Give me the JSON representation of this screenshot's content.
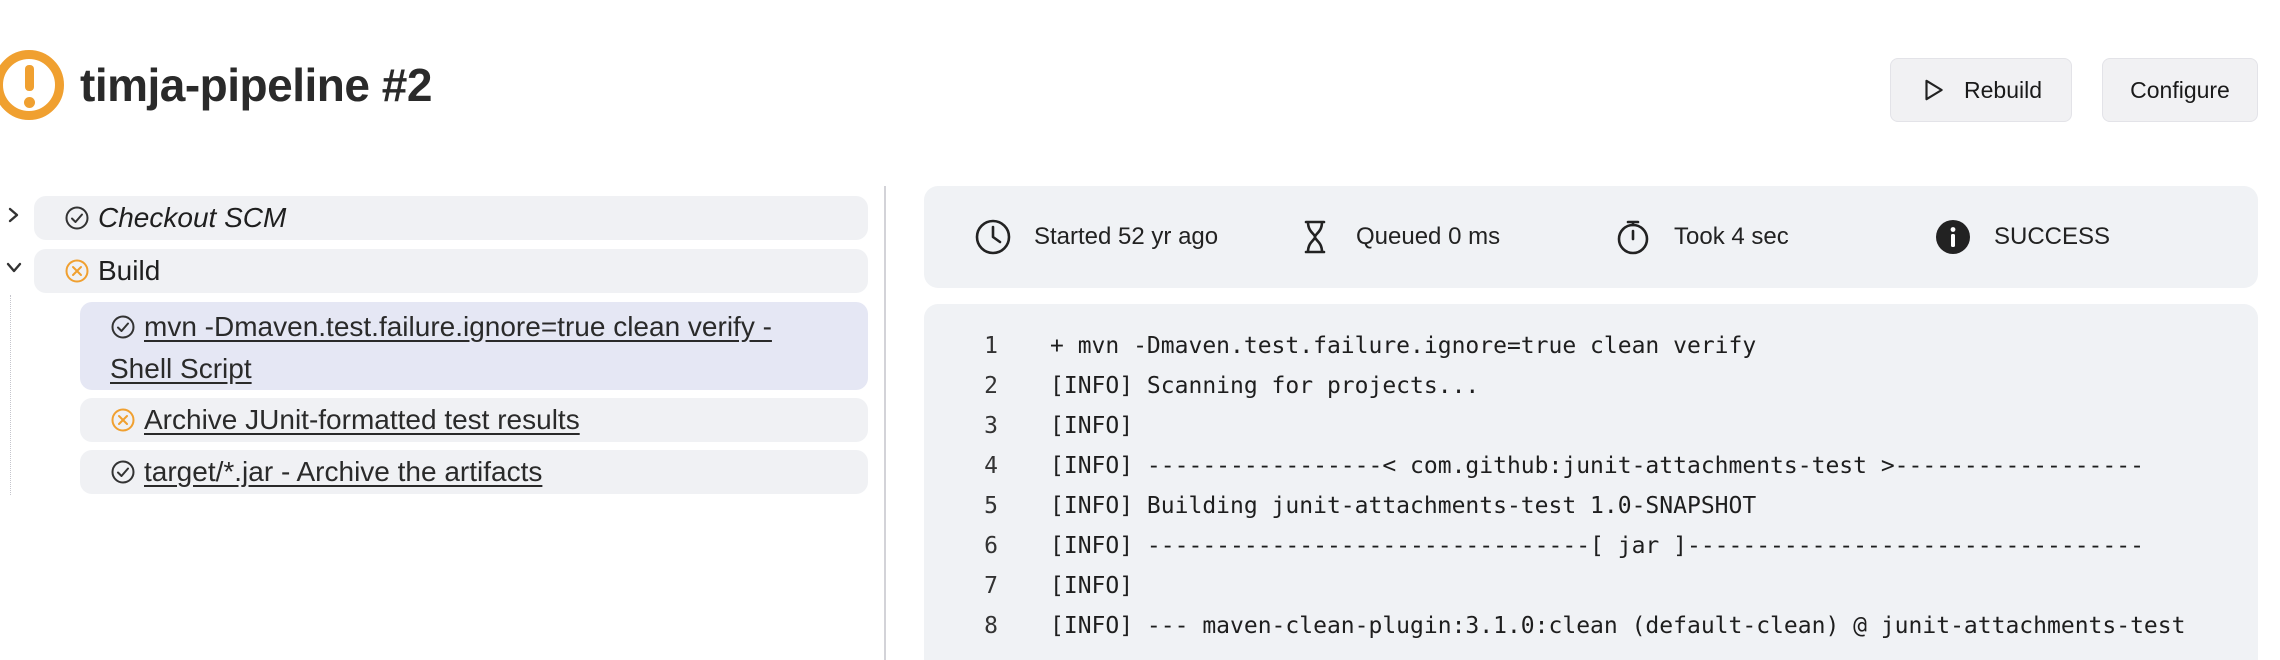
{
  "header": {
    "title": "timja-pipeline #2",
    "rebuild_label": "Rebuild",
    "configure_label": "Configure",
    "status_color": "#f0a030"
  },
  "stages": [
    {
      "label": "Checkout SCM",
      "status": "success",
      "expanded": false
    },
    {
      "label": "Build",
      "status": "failure",
      "expanded": true
    }
  ],
  "steps": [
    {
      "label": "mvn -Dmaven.test.failure.ignore=true clean verify - Shell Script",
      "line1": "mvn -Dmaven.test.failure.ignore=true clean verify -",
      "line2": "Shell Script",
      "status": "success",
      "selected": true
    },
    {
      "label": "Archive JUnit-formatted test results",
      "status": "failure",
      "selected": false
    },
    {
      "label": "target/*.jar - Archive the artifacts",
      "status": "success",
      "selected": false
    }
  ],
  "summary": {
    "started": "Started 52 yr ago",
    "queued": "Queued 0 ms",
    "took": "Took 4 sec",
    "result": "SUCCESS"
  },
  "console": {
    "lines": [
      {
        "n": "1",
        "text": "+ mvn -Dmaven.test.failure.ignore=true clean verify"
      },
      {
        "n": "2",
        "text": "[INFO] Scanning for projects..."
      },
      {
        "n": "3",
        "text": "[INFO]"
      },
      {
        "n": "4",
        "text": "[INFO] -----------------< com.github:junit-attachments-test >------------------"
      },
      {
        "n": "5",
        "text": "[INFO] Building junit-attachments-test 1.0-SNAPSHOT"
      },
      {
        "n": "6",
        "text": "[INFO] --------------------------------[ jar ]---------------------------------"
      },
      {
        "n": "7",
        "text": "[INFO]"
      },
      {
        "n": "8",
        "text": "[INFO] --- maven-clean-plugin:3.1.0:clean (default-clean) @ junit-attachments-test"
      }
    ]
  },
  "colors": {
    "warning": "#f0a030",
    "success": "#333333",
    "failure": "#f0a030"
  }
}
